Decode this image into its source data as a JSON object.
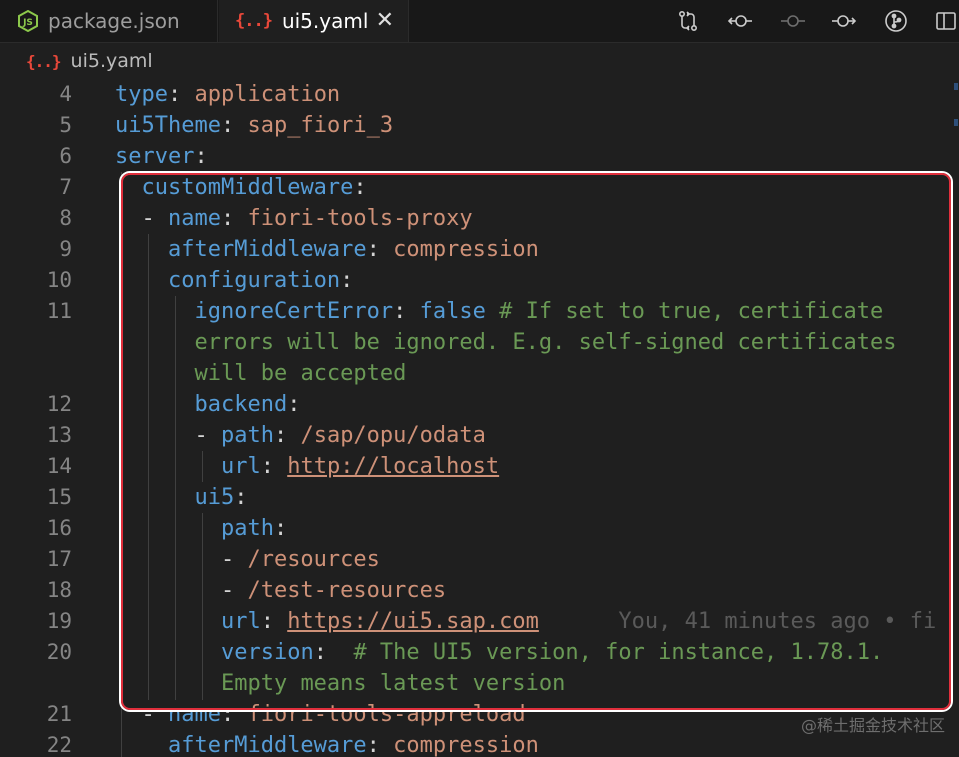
{
  "tabs": [
    {
      "label": "package.json",
      "icon": "nodejs-icon",
      "active": false
    },
    {
      "label": "ui5.yaml",
      "icon": "yaml-file-icon",
      "icon_text": "{..}",
      "active": true
    }
  ],
  "tab_close_glyph": "✕",
  "toolbar_icons": [
    "source-control-compare-icon",
    "go-back-icon",
    "timeline-icon",
    "go-forward-icon",
    "git-graph-icon",
    "split-editor-icon"
  ],
  "breadcrumb": {
    "icon_text": "{..}",
    "file": "ui5.yaml"
  },
  "code_lines": [
    {
      "num": "4",
      "tokens": [
        {
          "t": "type",
          "c": "k"
        },
        {
          "t": ": ",
          "c": "p"
        },
        {
          "t": "application",
          "c": "s"
        }
      ]
    },
    {
      "num": "5",
      "tokens": [
        {
          "t": "ui5Theme",
          "c": "k"
        },
        {
          "t": ": ",
          "c": "p"
        },
        {
          "t": "sap_fiori_3",
          "c": "s"
        }
      ]
    },
    {
      "num": "6",
      "tokens": [
        {
          "t": "server",
          "c": "k"
        },
        {
          "t": ":",
          "c": "p"
        }
      ]
    },
    {
      "num": "7",
      "tokens": [
        {
          "t": "  ",
          "c": "p"
        },
        {
          "t": "customMiddleware",
          "c": "k"
        },
        {
          "t": ":",
          "c": "p"
        }
      ]
    },
    {
      "num": "8",
      "tokens": [
        {
          "t": "  - ",
          "c": "p"
        },
        {
          "t": "name",
          "c": "k"
        },
        {
          "t": ": ",
          "c": "p"
        },
        {
          "t": "fiori-tools-proxy",
          "c": "s"
        }
      ]
    },
    {
      "num": "9",
      "tokens": [
        {
          "t": "    ",
          "c": "p"
        },
        {
          "t": "afterMiddleware",
          "c": "k"
        },
        {
          "t": ": ",
          "c": "p"
        },
        {
          "t": "compression",
          "c": "s"
        }
      ]
    },
    {
      "num": "10",
      "tokens": [
        {
          "t": "    ",
          "c": "p"
        },
        {
          "t": "configuration",
          "c": "k"
        },
        {
          "t": ":",
          "c": "p"
        }
      ]
    },
    {
      "num": "11",
      "tokens": [
        {
          "t": "      ",
          "c": "p"
        },
        {
          "t": "ignoreCertError",
          "c": "k"
        },
        {
          "t": ": ",
          "c": "p"
        },
        {
          "t": "false",
          "c": "b"
        },
        {
          "t": " # If set to true, certificate",
          "c": "c"
        }
      ]
    },
    {
      "num": "",
      "tokens": [
        {
          "t": "      ",
          "c": "p"
        },
        {
          "t": "errors will be ignored. E.g. self-signed certificates",
          "c": "c"
        }
      ]
    },
    {
      "num": "",
      "tokens": [
        {
          "t": "      ",
          "c": "p"
        },
        {
          "t": "will be accepted",
          "c": "c"
        }
      ]
    },
    {
      "num": "12",
      "tokens": [
        {
          "t": "      ",
          "c": "p"
        },
        {
          "t": "backend",
          "c": "k"
        },
        {
          "t": ":",
          "c": "p"
        }
      ]
    },
    {
      "num": "13",
      "tokens": [
        {
          "t": "      - ",
          "c": "p"
        },
        {
          "t": "path",
          "c": "k"
        },
        {
          "t": ": ",
          "c": "p"
        },
        {
          "t": "/sap/opu/odata",
          "c": "s"
        }
      ]
    },
    {
      "num": "14",
      "tokens": [
        {
          "t": "        ",
          "c": "p"
        },
        {
          "t": "url",
          "c": "k"
        },
        {
          "t": ": ",
          "c": "p"
        },
        {
          "t": "http://localhost",
          "c": "u"
        }
      ]
    },
    {
      "num": "15",
      "tokens": [
        {
          "t": "      ",
          "c": "p"
        },
        {
          "t": "ui5",
          "c": "k"
        },
        {
          "t": ":",
          "c": "p"
        }
      ]
    },
    {
      "num": "16",
      "tokens": [
        {
          "t": "        ",
          "c": "p"
        },
        {
          "t": "path",
          "c": "k"
        },
        {
          "t": ":",
          "c": "p"
        }
      ]
    },
    {
      "num": "17",
      "tokens": [
        {
          "t": "        - ",
          "c": "p"
        },
        {
          "t": "/resources",
          "c": "s"
        }
      ]
    },
    {
      "num": "18",
      "tokens": [
        {
          "t": "        - ",
          "c": "p"
        },
        {
          "t": "/test-resources",
          "c": "s"
        }
      ]
    },
    {
      "num": "19",
      "tokens": [
        {
          "t": "        ",
          "c": "p"
        },
        {
          "t": "url",
          "c": "k"
        },
        {
          "t": ": ",
          "c": "p"
        },
        {
          "t": "https://ui5.sap.com",
          "c": "u"
        },
        {
          "t": "      You, 41 minutes ago • fi",
          "c": "blame"
        }
      ]
    },
    {
      "num": "20",
      "tokens": [
        {
          "t": "        ",
          "c": "p"
        },
        {
          "t": "version",
          "c": "k"
        },
        {
          "t": ":  ",
          "c": "p"
        },
        {
          "t": "# The UI5 version, for instance, 1.78.1.",
          "c": "c"
        }
      ]
    },
    {
      "num": "",
      "tokens": [
        {
          "t": "        ",
          "c": "p"
        },
        {
          "t": "Empty means latest version",
          "c": "c"
        }
      ]
    },
    {
      "num": "21",
      "tokens": [
        {
          "t": "  - ",
          "c": "p"
        },
        {
          "t": "name",
          "c": "k"
        },
        {
          "t": ": ",
          "c": "p"
        },
        {
          "t": "fiori-tools-appreload",
          "c": "s"
        }
      ]
    },
    {
      "num": "22",
      "tokens": [
        {
          "t": "    ",
          "c": "p"
        },
        {
          "t": "afterMiddleware",
          "c": "k"
        },
        {
          "t": ": ",
          "c": "p"
        },
        {
          "t": "compression",
          "c": "s"
        }
      ]
    }
  ],
  "watermark": "@稀土掘金技术社区",
  "colors": {
    "key": "#569cd6",
    "string": "#ce9178",
    "comment": "#6a9955",
    "highlight_border": "#e02f3c",
    "yaml_icon": "#e8483a",
    "node_icon": "#8cc84b"
  }
}
